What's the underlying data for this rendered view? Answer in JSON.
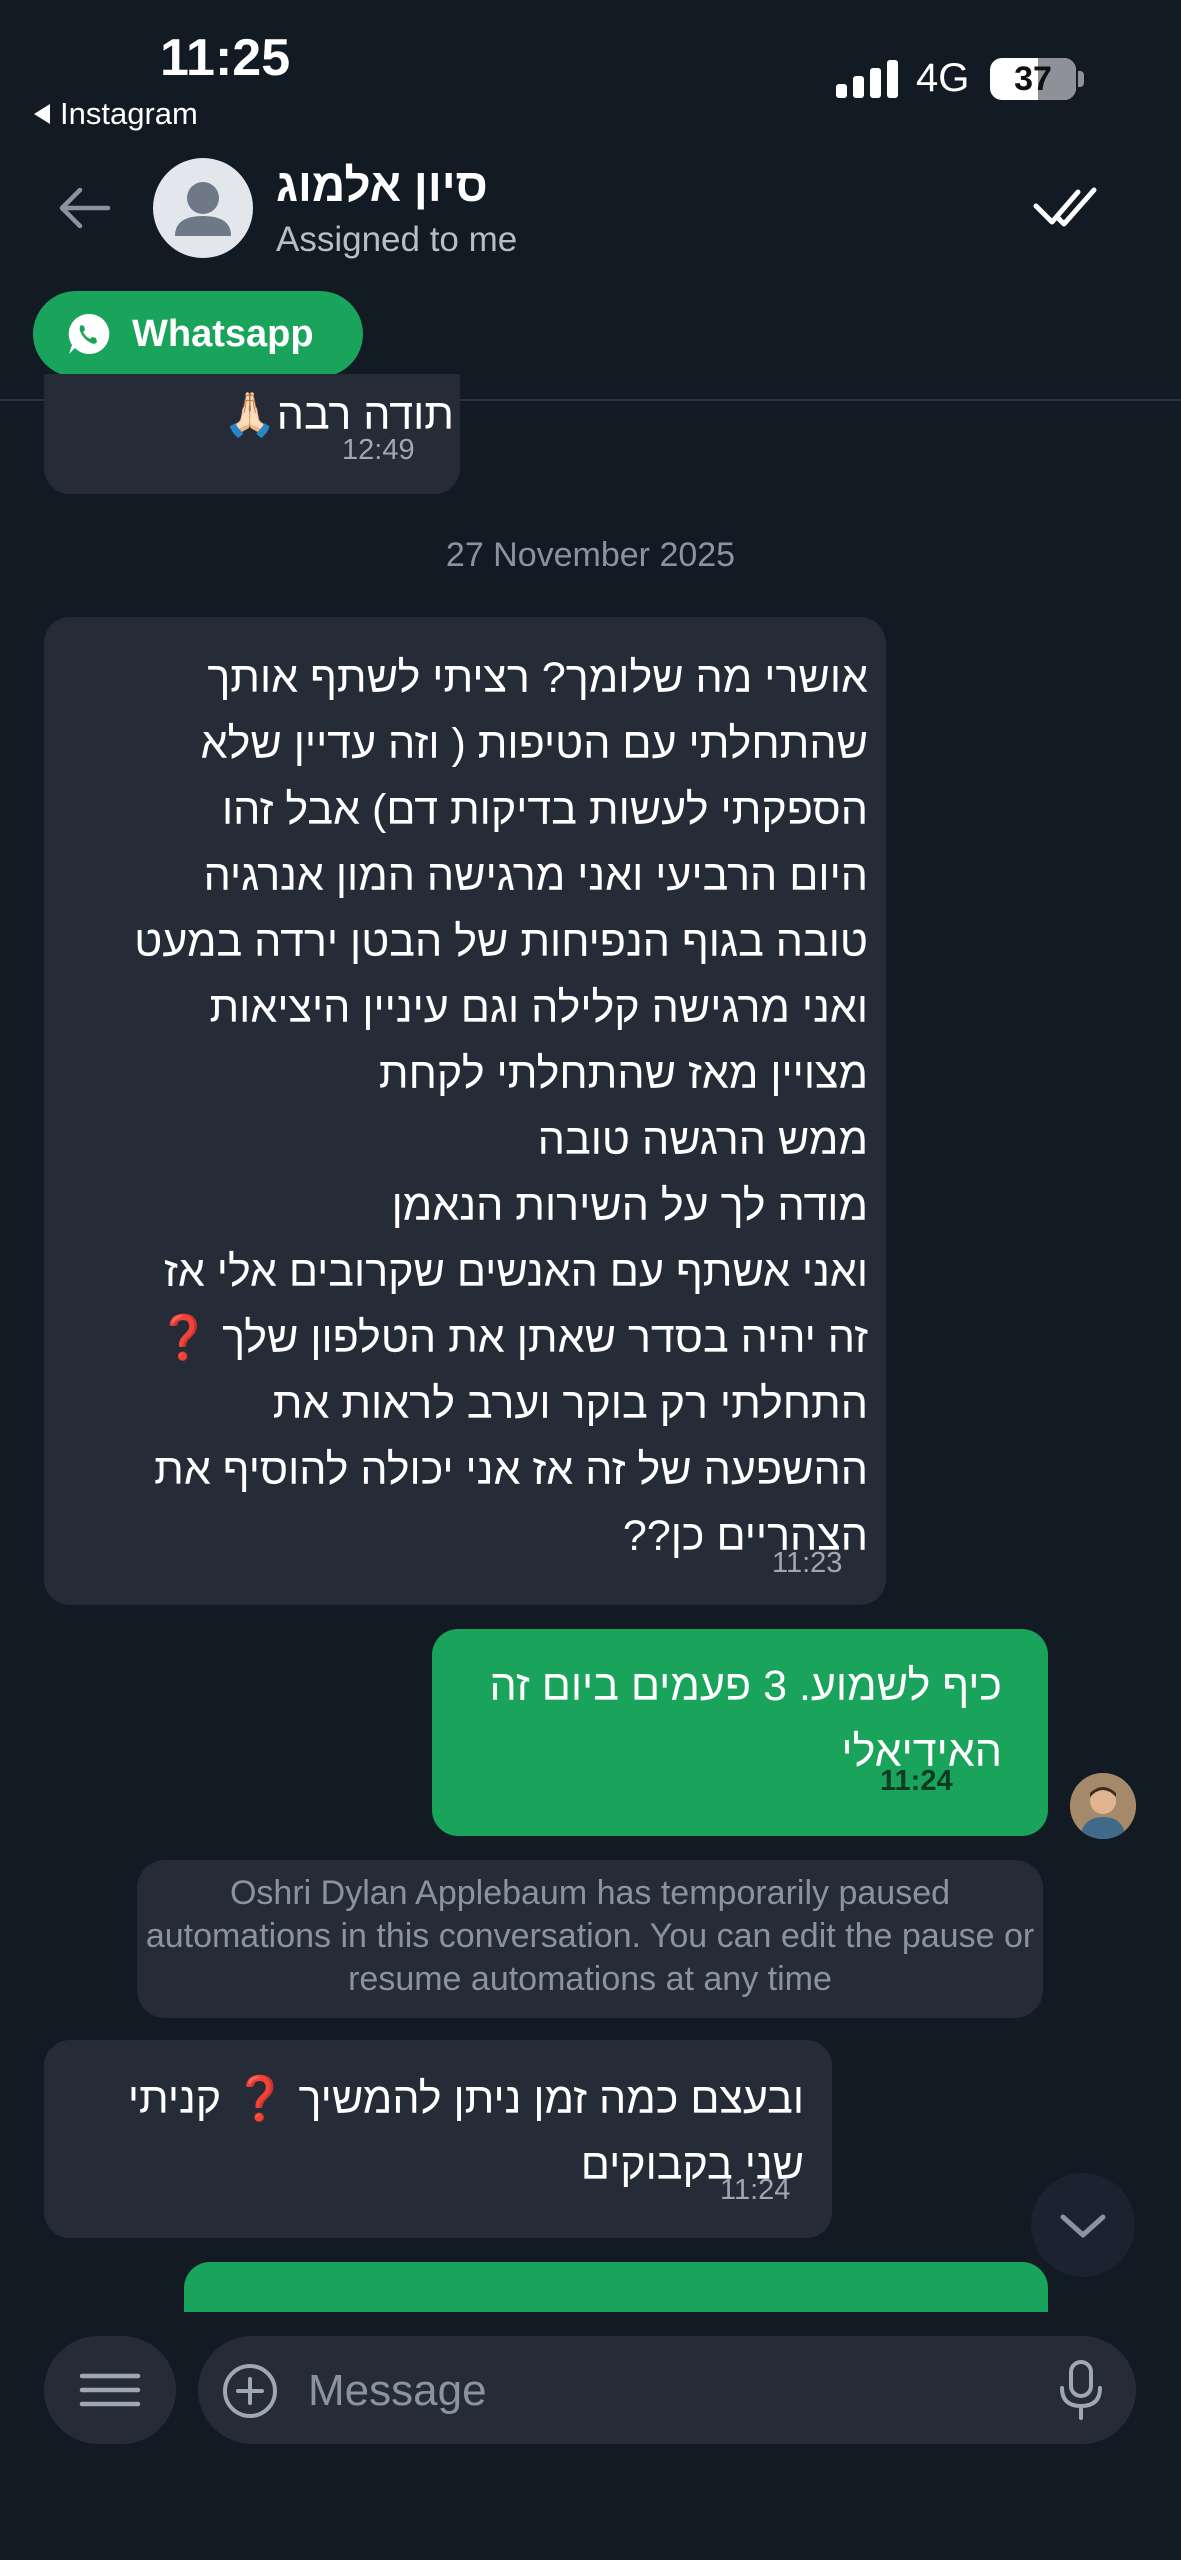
{
  "status_bar": {
    "time": "11:25",
    "back_app": "Instagram",
    "network": "4G",
    "battery": "37",
    "battery_level": 0.37
  },
  "header": {
    "contact_name": "סיון אלמוג",
    "subtitle": "Assigned to me",
    "channel_chip": "Whatsapp"
  },
  "chat": {
    "messages": [
      {
        "direction": "in",
        "text": "תודה רבה🙏🏻",
        "time": "12:49"
      },
      {
        "direction": "in",
        "text": "אושרי מה שלומך? רציתי לשתף אותך\nשהתחלתי עם הטיפות ( וזה עדיין שלא\nהספקתי לעשות בדיקות דם) אבל זהו\nהיום הרביעי ואני מרגישה המון אנרגיה\nטובה בגוף הנפיחות של הבטן ירדה במעט\nואני מרגישה קלילה וגם עיניין היציאות\nמצויין מאז שהתחלתי לקחת\nממש הרגשה טובה\nמודה לך על השירות הנאמן\nואני אשתף עם האנשים שקרובים אלי אז\nזה יהיה בסדר שאתן את הטלפון שלך ❓\nהתחלתי רק בוקר וערב לראות את\nההשפעה של זה אז אני יכולה להוסיף את\nהצהריים כן??",
        "time": "11:23"
      },
      {
        "direction": "out",
        "text": "כיף לשמוע. 3 פעמים ביום זה האידיאלי",
        "time": "11:24"
      },
      {
        "direction": "in",
        "text": "ובעצם כמה זמן ניתן להמשיך ❓ קניתי שני בקבוקים",
        "time": "11:24"
      }
    ],
    "date_separator": "27 November 2025",
    "system_note": "Oshri Dylan Applebaum has temporarily paused automations in this conversation. You can edit the pause or resume automations at any time"
  },
  "composer": {
    "placeholder": "Message"
  },
  "colors": {
    "background": "#121a24",
    "incoming_bubble": "#262c37",
    "outgoing_bubble": "#1aa35a",
    "whatsapp_chip": "#1aa35a"
  },
  "icons": {
    "back": "arrow-left-icon",
    "avatar": "user-silhouette-icon",
    "resolve": "checkmark-icon",
    "whatsapp": "whatsapp-icon",
    "scroll": "chevron-down-icon",
    "menu": "hamburger-menu-icon",
    "attach": "plus-circle-icon",
    "voice": "microphone-icon"
  }
}
